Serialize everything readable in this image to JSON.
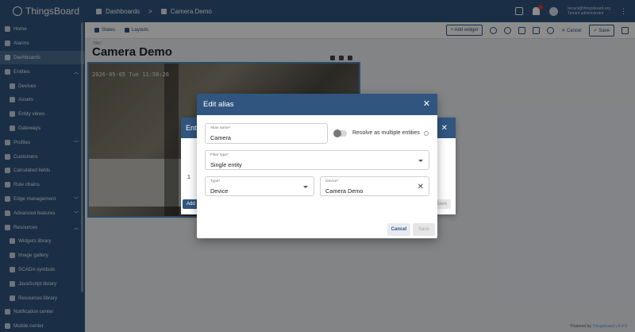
{
  "app": {
    "name": "ThingsBoard"
  },
  "breadcrumb": {
    "parent": "Dashboards",
    "current": "Camera Demo"
  },
  "user": {
    "email": "tenant@thingsboard.org",
    "role": "Tenant administrator"
  },
  "sidebar": {
    "items": [
      {
        "label": "Home"
      },
      {
        "label": "Alarms"
      },
      {
        "label": "Dashboards"
      },
      {
        "label": "Entities"
      },
      {
        "label": "Devices"
      },
      {
        "label": "Assets"
      },
      {
        "label": "Entity views"
      },
      {
        "label": "Gateways"
      },
      {
        "label": "Profiles"
      },
      {
        "label": "Customers"
      },
      {
        "label": "Calculated fields"
      },
      {
        "label": "Rule chains"
      },
      {
        "label": "Edge management"
      },
      {
        "label": "Advanced features"
      },
      {
        "label": "Resources"
      },
      {
        "label": "Widgets library"
      },
      {
        "label": "Image gallery"
      },
      {
        "label": "SCADA symbols"
      },
      {
        "label": "JavaScript library"
      },
      {
        "label": "Resources library"
      },
      {
        "label": "Notification center"
      },
      {
        "label": "Mobile center"
      }
    ]
  },
  "toolbar": {
    "states_label": "States",
    "layouts_label": "Layouts",
    "add_widget_label": "Add widget",
    "cancel_label": "Cancel",
    "save_label": "Save"
  },
  "dashboard": {
    "title_label": "Title*",
    "title": "Camera Demo",
    "camera_timestamp": "2026-05-05 Tue 11:58:26"
  },
  "behind_dialog": {
    "title": "Enti",
    "row_index": "1",
    "add_label": "Add",
    "save_label": "Save"
  },
  "dialog": {
    "title": "Edit alias",
    "alias_name_label": "Alias name*",
    "alias_name_value": "Camera",
    "resolve_multiple_label": "Resolve as multiple entities",
    "filter_type_label": "Filter type*",
    "filter_type_value": "Single entity",
    "type_label": "Type*",
    "type_value": "Device",
    "device_label": "Device*",
    "device_value": "Camera Demo",
    "cancel_label": "Cancel",
    "save_label": "Save"
  },
  "footer": {
    "powered_prefix": "Powered by ",
    "powered_brand": "Thingsboard v.4.4.0"
  }
}
